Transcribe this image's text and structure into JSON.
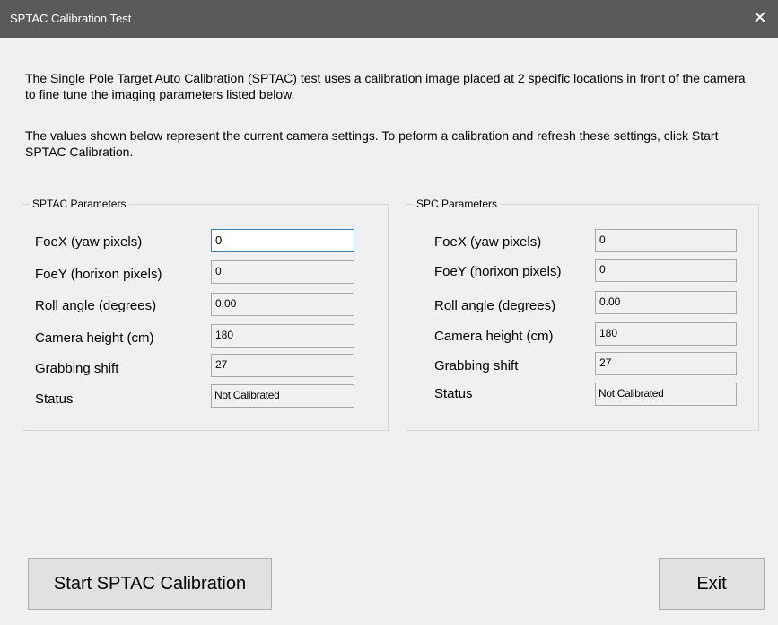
{
  "window": {
    "title": "SPTAC Calibration Test",
    "close_glyph": "✕"
  },
  "description": {
    "paragraph1": "The Single Pole Target Auto Calibration (SPTAC) test uses a calibration image placed at 2 specific locations in front of the camera to fine tune the imaging parameters listed below.",
    "paragraph2": "The values shown below represent the current camera settings. To peform a calibration and refresh these settings, click Start SPTAC Calibration."
  },
  "sptac": {
    "group_label": "SPTAC Parameters",
    "rows": [
      {
        "label": "FoeX (yaw pixels)",
        "value": "0"
      },
      {
        "label": "FoeY (horixon pixels)",
        "value": "0"
      },
      {
        "label": "Roll angle (degrees)",
        "value": "0.00"
      },
      {
        "label": "Camera height (cm)",
        "value": "180"
      },
      {
        "label": "Grabbing shift",
        "value": "27"
      },
      {
        "label": "Status",
        "value": "Not Calibrated"
      }
    ]
  },
  "spc": {
    "group_label": "SPC Parameters",
    "rows": [
      {
        "label": "FoeX (yaw pixels)",
        "value": "0"
      },
      {
        "label": "FoeY (horixon pixels)",
        "value": "0"
      },
      {
        "label": "Roll angle (degrees)",
        "value": "0.00"
      },
      {
        "label": "Camera height (cm)",
        "value": "180"
      },
      {
        "label": "Grabbing shift",
        "value": "27"
      },
      {
        "label": "Status",
        "value": "Not Calibrated"
      }
    ]
  },
  "buttons": {
    "start_label": "Start SPTAC Calibration",
    "exit_label": "Exit"
  },
  "colors": {
    "titlebar": "#5a5a5a",
    "window_bg": "#f0f0f0",
    "focus_border": "#3c7fb1"
  },
  "icons": {
    "close": "close-icon"
  }
}
